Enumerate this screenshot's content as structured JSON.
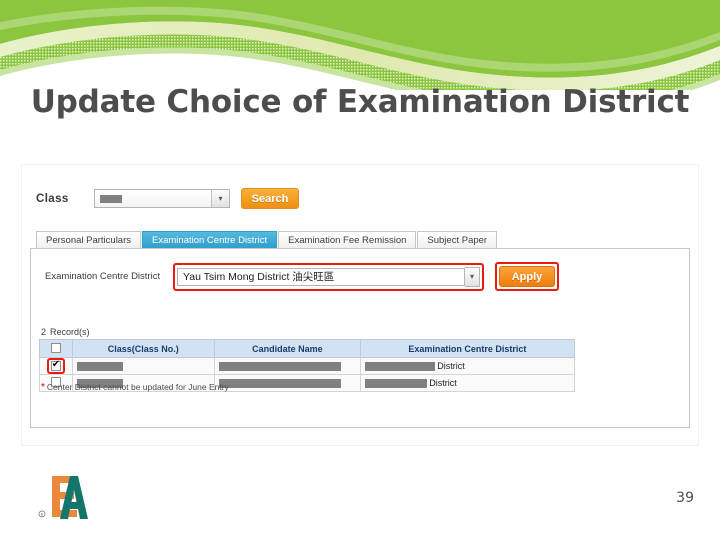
{
  "slide": {
    "title": "Update Choice of Examination District",
    "page_number": "39",
    "logo_name": "hkeaa-logo",
    "accent_green": "#8cc63e",
    "title_color": "#4d4d4d"
  },
  "search_bar": {
    "class_label": "Class",
    "class_value": "",
    "dropdown_arrow": "chevron-down-icon",
    "search_label": "Search",
    "search_color": "#f09a1e"
  },
  "tabs": [
    {
      "label": "Personal Particulars",
      "active": false
    },
    {
      "label": "Examination Centre District",
      "active": true
    },
    {
      "label": "Examination Fee Remission",
      "active": false
    },
    {
      "label": "Subject Paper",
      "active": false
    }
  ],
  "district_form": {
    "label": "Examination Centre District",
    "selected_value": "Yau Tsim Mong District 油尖旺區",
    "dropdown_arrow": "chevron-down-icon",
    "apply_label": "Apply",
    "apply_color": "#f0830f",
    "highlight_color": "#e81b12"
  },
  "records": {
    "count_text": "2",
    "count_suffix": "Record(s)",
    "columns": [
      "",
      "Class(Class No.)",
      "Candidate Name",
      "Examination Centre District"
    ],
    "header_bg": "#d3e2f2",
    "header_text_color": "#183c69",
    "rows": [
      {
        "checked": true,
        "highlighted": true,
        "class_no": "[redacted]",
        "candidate_name": "[redacted]",
        "district_prefix": "[redacted]",
        "district_suffix": "District"
      },
      {
        "checked": false,
        "highlighted": false,
        "class_no": "[redacted]",
        "candidate_name": "[redacted]",
        "district_prefix": "[redacted]",
        "district_suffix": "District"
      }
    ],
    "footnote": "Center District cannot be updated for June Entry",
    "footnote_star": "*"
  }
}
